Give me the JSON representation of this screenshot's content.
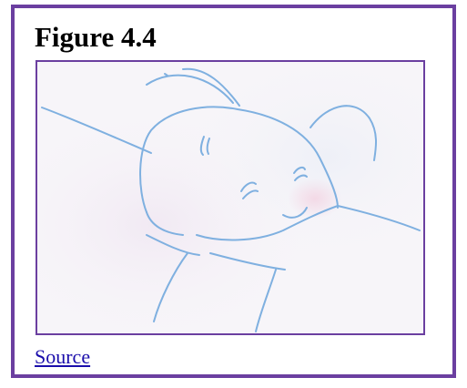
{
  "figure": {
    "title": "Figure 4.4",
    "image_subject": "child-drawing-icon",
    "source_label": "Source"
  },
  "colors": {
    "frame_border": "#6b3fa0",
    "drawing_stroke": "#7fb0e0",
    "link": "#1a0dab"
  }
}
